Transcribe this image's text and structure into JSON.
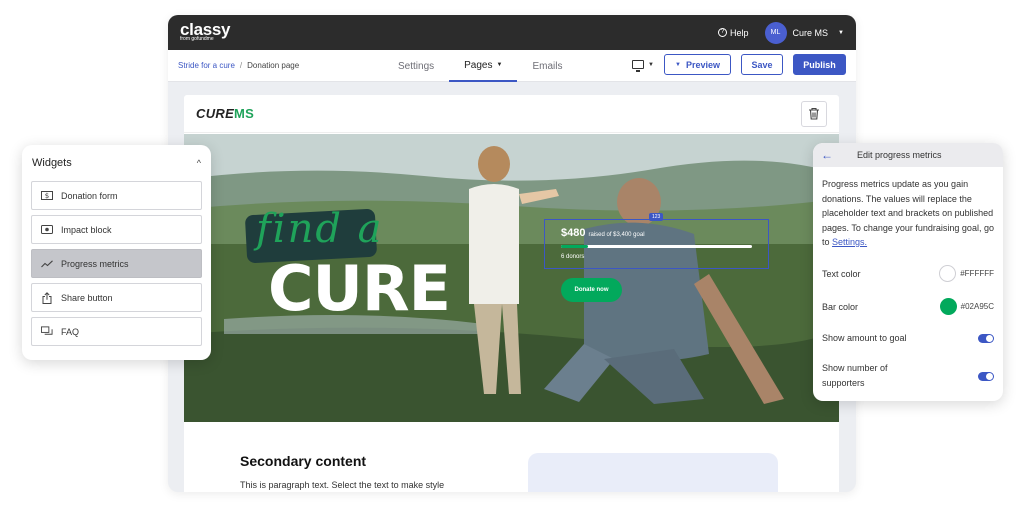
{
  "topbar": {
    "logo": "classy",
    "logo_sub": "from gofundme",
    "help": "Help",
    "avatar_initials": "ML",
    "account_name": "Cure MS"
  },
  "breadcrumb": {
    "parent": "Stride for a cure",
    "separator": "/",
    "current": "Donation page"
  },
  "tabs": [
    {
      "label": "Settings"
    },
    {
      "label": "Pages"
    },
    {
      "label": "Emails"
    }
  ],
  "actions": {
    "preview": "Preview",
    "save": "Save",
    "publish": "Publish"
  },
  "canvas": {
    "brand_prefix": "CURE",
    "brand_suffix": "MS",
    "hero": {
      "script_text": "find a",
      "headline": "CURE",
      "badge": "123",
      "amount": "$480",
      "raised_text": "raised of $3,400 goal",
      "progress": 0.14,
      "donors": "6 donors",
      "donate_button": "Donate now"
    },
    "secondary_title": "Secondary content",
    "paragraph": "This is paragraph text. Select the text to make style"
  },
  "widgets": {
    "title": "Widgets",
    "items": [
      {
        "label": "Donation form",
        "icon": "dollar-icon"
      },
      {
        "label": "Impact block",
        "icon": "impact-icon"
      },
      {
        "label": "Progress metrics",
        "icon": "trend-icon"
      },
      {
        "label": "Share button",
        "icon": "share-icon"
      },
      {
        "label": "FAQ",
        "icon": "faq-icon"
      }
    ]
  },
  "edit_panel": {
    "title": "Edit progress metrics",
    "description": "Progress metrics update as you gain donations. The values will replace the placeholder text and brackets on published pages. To change your fundraising goal, go to",
    "settings_link": "Settings.",
    "text_color_label": "Text color",
    "text_color_value": "#FFFFFF",
    "bar_color_label": "Bar color",
    "bar_color_value": "#02A95C",
    "show_amount_label": "Show amount to goal",
    "show_supporters_label": "Show number of supporters",
    "show_amount_on": true,
    "show_supporters_on": true
  },
  "colors": {
    "accent": "#3C57C4",
    "bar": "#02A95C",
    "text": "#FFFFFF"
  }
}
